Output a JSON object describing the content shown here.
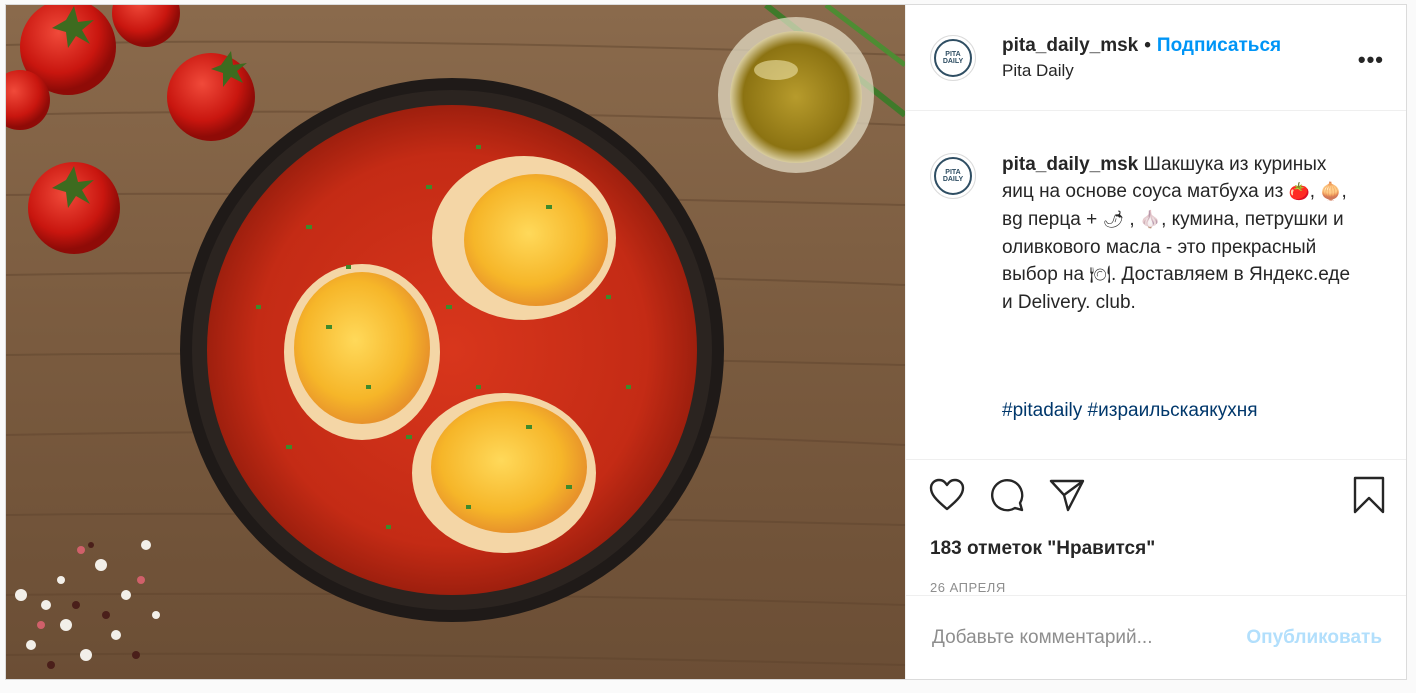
{
  "header": {
    "username": "pita_daily_msk",
    "separator": "•",
    "follow_label": "Подписаться",
    "location": "Pita Daily",
    "more_label": "•••",
    "avatar_text": "PITA DAILY"
  },
  "caption": {
    "username": "pita_daily_msk",
    "text_part1": "Шакшука из куриных яиц на основе соуса матбуха из ",
    "emoji_tomato": "🍅",
    "text_part2": ", ",
    "emoji_onion": "🧅",
    "text_part3": ", вg перца + ",
    "emoji_pepper": "🌶",
    "text_part4": " , ",
    "emoji_garlic": "🧄",
    "text_part5": ", кумина, петрушки и оливкового масла - это прекрасный выбор на ",
    "emoji_plate": "🍽",
    "text_part6": ". Доставляем в Яндекс.еде и Delivery. club.",
    "hashtags": "#pitadaily #израильскаякухня"
  },
  "actions": {
    "like_icon": "heart-icon",
    "comment_icon": "comment-icon",
    "share_icon": "share-icon",
    "save_icon": "bookmark-icon"
  },
  "likes": "183 отметок \"Нравится\"",
  "date": "26 АПРЕЛЯ",
  "comment": {
    "placeholder": "Добавьте комментарий...",
    "publish_label": "Опубликовать"
  },
  "colors": {
    "accent": "#0095f6",
    "publish_disabled": "#b2dffc",
    "hashtag": "#00376b"
  }
}
